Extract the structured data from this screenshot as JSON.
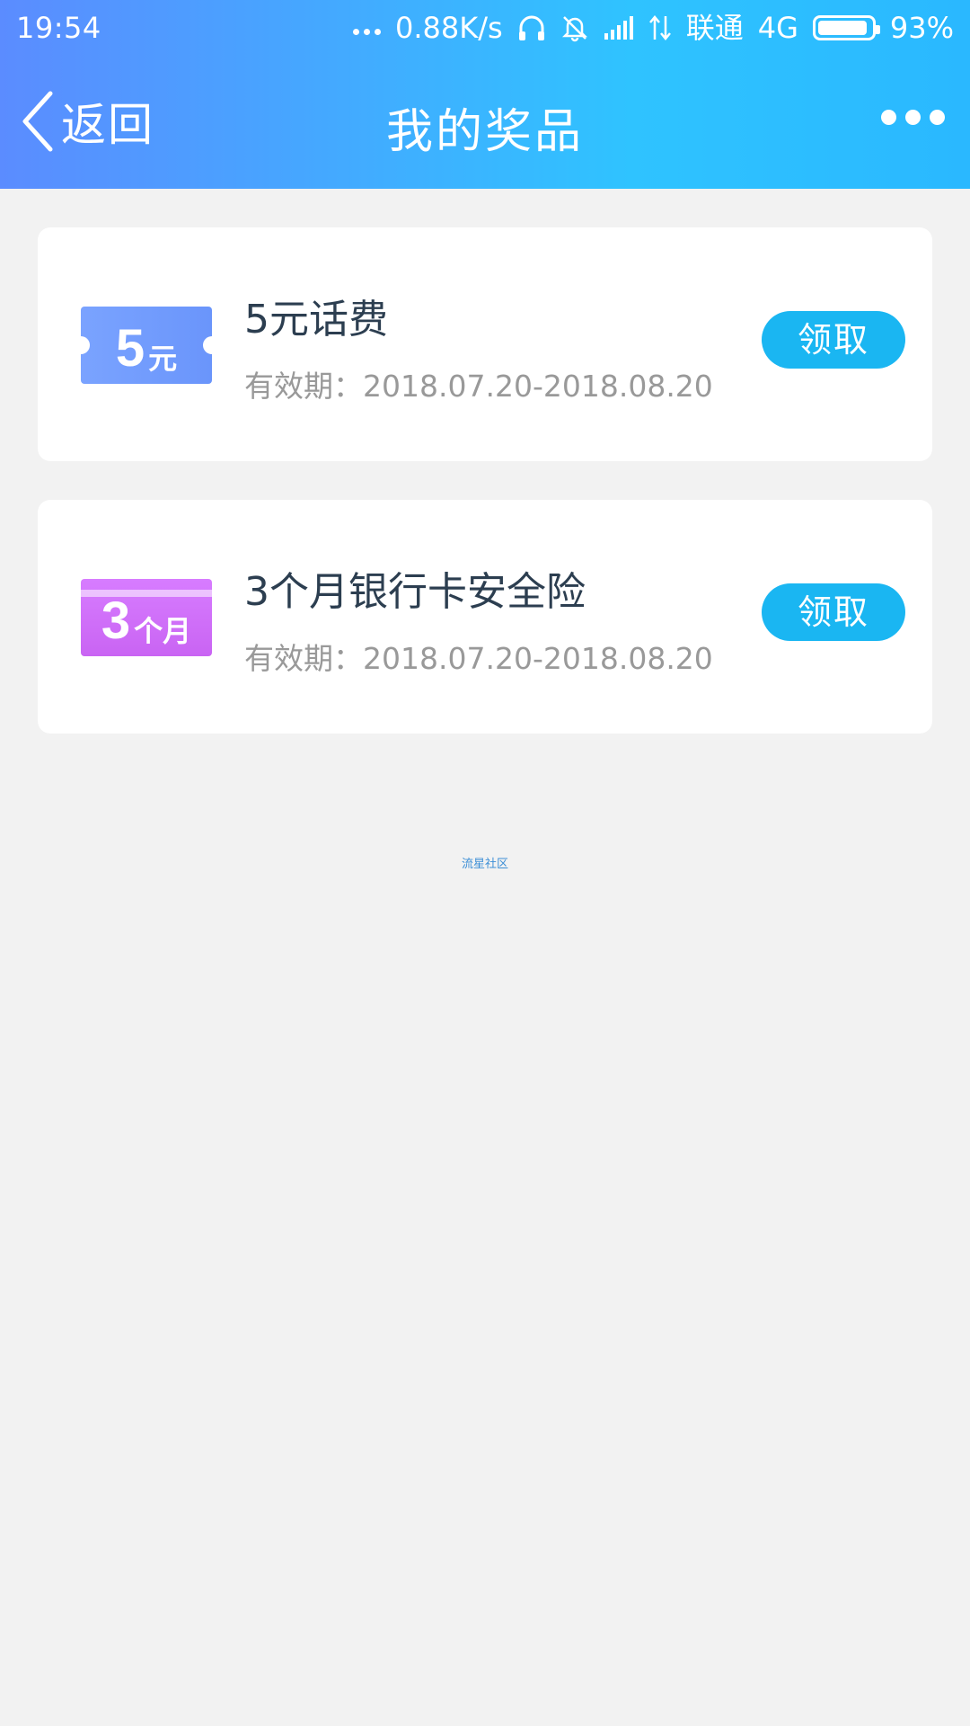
{
  "status_bar": {
    "time": "19:54",
    "speed": "0.88K/s",
    "carrier": "联通",
    "network": "4G",
    "battery_percent": "93%",
    "battery_level": 0.93
  },
  "nav": {
    "back_label": "返回",
    "title": "我的奖品"
  },
  "prizes": [
    {
      "coupon_big": "5",
      "coupon_small": "元",
      "name": "5元话费",
      "validity": "有效期：2018.07.20-2018.08.20",
      "claim_label": "领取"
    },
    {
      "coupon_big": "3",
      "coupon_small": "个月",
      "name": "3个月银行卡安全险",
      "validity": "有效期：2018.07.20-2018.08.20",
      "claim_label": "领取"
    }
  ],
  "watermark": "流星社区",
  "colors": {
    "accent": "#1ab6f2",
    "header_start": "#5b8cff",
    "header_end": "#2ab8ff",
    "coupon_blue": "#7aa3ff",
    "coupon_purple": "#d77cff"
  }
}
